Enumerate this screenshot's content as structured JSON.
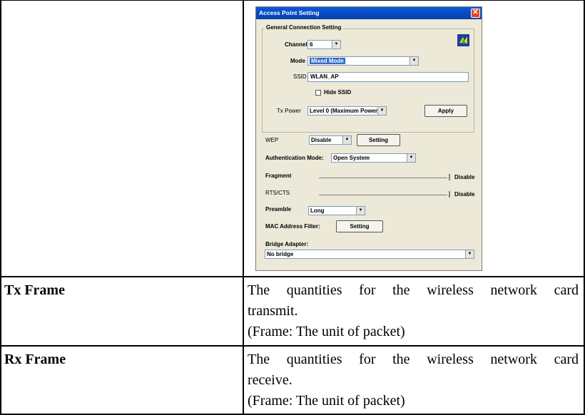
{
  "dialog": {
    "title": "Access Point Setting",
    "close_icon": "close-icon",
    "group_title": "General Connection Setting",
    "channel": {
      "label": "Channel",
      "value": "6"
    },
    "mode": {
      "label": "Mode",
      "value": "Mixed Mode"
    },
    "ssid": {
      "label": "SSID",
      "value": "WLAN_AP"
    },
    "hide_ssid": {
      "label": "Hide SSID",
      "checked": false
    },
    "tx_power": {
      "label": "Tx Power",
      "value": "Level 0 (Maximum Power)"
    },
    "apply_label": "Apply",
    "wep": {
      "label": "WEP",
      "value": "Disable",
      "setting_label": "Setting"
    },
    "auth": {
      "label": "Authentication Mode:",
      "value": "Open System"
    },
    "fragment": {
      "label": "Fragment",
      "value": "Disable"
    },
    "rts": {
      "label": "RTS/CTS",
      "value": "Disable"
    },
    "preamble": {
      "label": "Preamble",
      "value": "Long"
    },
    "mac_filter": {
      "label": "MAC Address Filter:",
      "setting_label": "Setting"
    },
    "bridge": {
      "label": "Bridge Adapter:",
      "value": "No bridge"
    }
  },
  "rows": [
    {
      "term": "Tx Frame",
      "desc_line1": "The quantities for the wireless network card",
      "desc_line2": "transmit.",
      "desc_line3": "(Frame: The unit of packet)"
    },
    {
      "term": "Rx Frame",
      "desc_line1": "The quantities for the wireless network card",
      "desc_line2": "receive.",
      "desc_line3": "(Frame: The unit of packet)"
    }
  ]
}
